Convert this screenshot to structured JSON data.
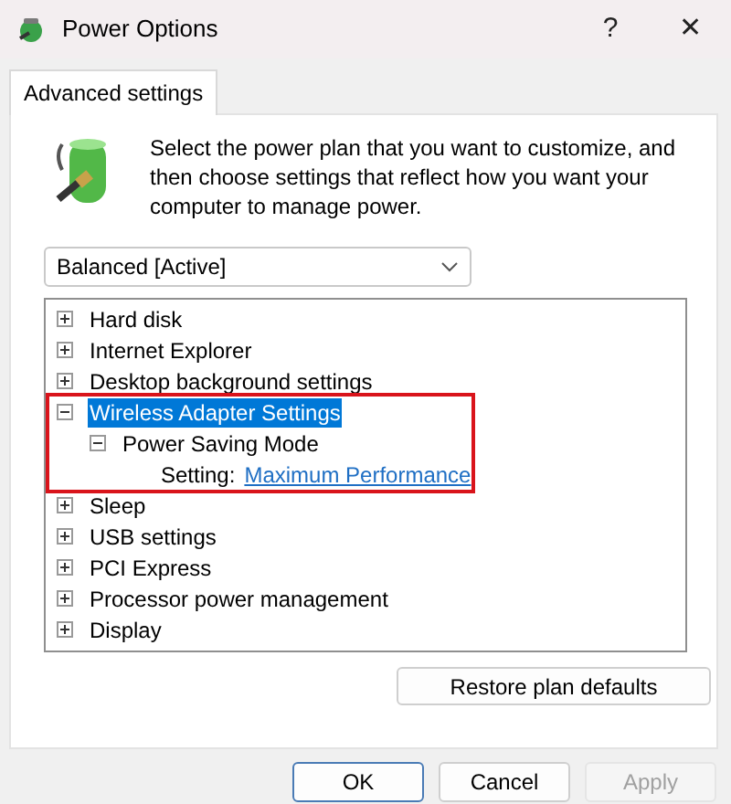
{
  "window": {
    "title": "Power Options",
    "buttons": [
      "?",
      "✕"
    ]
  },
  "tabs": [
    {
      "label": "Advanced settings",
      "selected": true
    }
  ],
  "intro": "Select the power plan that you want to customize, and then choose settings that reflect how you want your computer to manage power.",
  "plan": {
    "value": "Balanced [Active]"
  },
  "tree": [
    {
      "kind": "group",
      "label": "Hard disk",
      "expanded": false,
      "selected": false,
      "highlighted": false
    },
    {
      "kind": "group",
      "label": "Internet Explorer",
      "expanded": false,
      "selected": false,
      "highlighted": false
    },
    {
      "kind": "group",
      "label": "Desktop background settings",
      "expanded": false,
      "selected": false,
      "highlighted": false
    },
    {
      "kind": "group",
      "label": "Wireless Adapter Settings",
      "expanded": true,
      "selected": true,
      "highlighted": true,
      "children": [
        {
          "kind": "group",
          "label": "Power Saving Mode",
          "expanded": true,
          "selected": false,
          "children": [
            {
              "kind": "setting",
              "label": "Setting:",
              "value": "Maximum Performance",
              "selected": false
            }
          ]
        }
      ]
    },
    {
      "kind": "group",
      "label": "Sleep",
      "expanded": false,
      "selected": false,
      "highlighted": false
    },
    {
      "kind": "group",
      "label": "USB settings",
      "expanded": false,
      "selected": false,
      "highlighted": false
    },
    {
      "kind": "group",
      "label": "PCI Express",
      "expanded": false,
      "selected": false,
      "highlighted": false
    },
    {
      "kind": "group",
      "label": "Processor power management",
      "expanded": false,
      "selected": false,
      "highlighted": false
    },
    {
      "kind": "group",
      "label": "Display",
      "expanded": false,
      "selected": false,
      "highlighted": false
    }
  ],
  "restore_button": "Restore plan defaults",
  "buttons": [
    {
      "label": "OK",
      "disabled": false,
      "default": true
    },
    {
      "label": "Cancel",
      "disabled": false,
      "default": false
    },
    {
      "label": "Apply",
      "disabled": true,
      "default": false
    }
  ]
}
